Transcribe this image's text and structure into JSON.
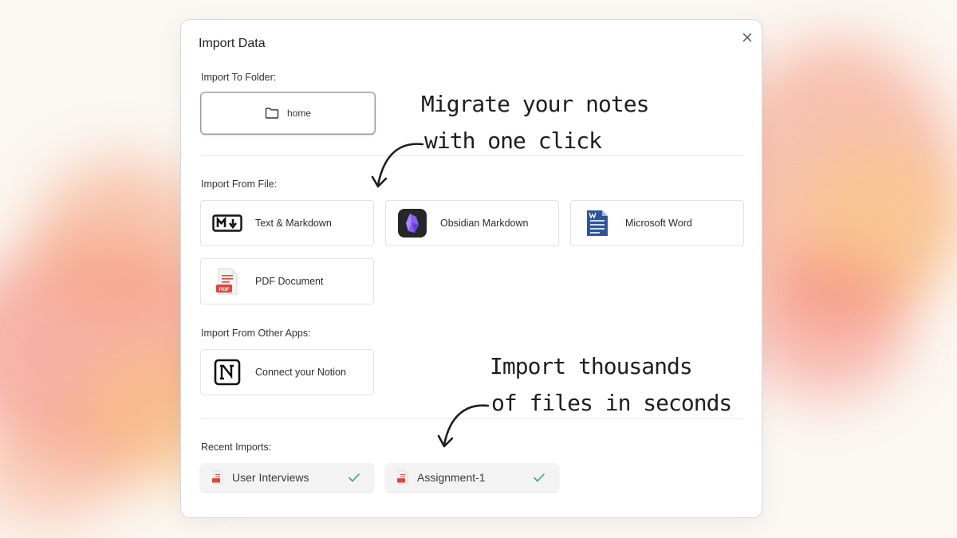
{
  "dialog": {
    "title": "Import Data",
    "close_icon": "close-icon"
  },
  "folder": {
    "label": "Import To Folder:",
    "value": "home",
    "icon": "folder-icon"
  },
  "file_import": {
    "label": "Import From File:",
    "options": [
      {
        "label": "Text & Markdown",
        "icon": "markdown-icon"
      },
      {
        "label": "Obsidian Markdown",
        "icon": "obsidian-icon"
      },
      {
        "label": "Microsoft Word",
        "icon": "word-icon"
      },
      {
        "label": "PDF Document",
        "icon": "pdf-icon"
      }
    ]
  },
  "apps_import": {
    "label": "Import From Other Apps:",
    "options": [
      {
        "label": "Connect your Notion",
        "icon": "notion-icon"
      }
    ]
  },
  "recent": {
    "label": "Recent Imports:",
    "items": [
      {
        "name": "User Interviews",
        "status": "done"
      },
      {
        "name": "Assignment-1",
        "status": "done"
      }
    ]
  },
  "annotations": {
    "top_line1": "Migrate your notes",
    "top_line2": "with one click",
    "bottom_line1": "Import thousands",
    "bottom_line2": "of files in seconds"
  },
  "colors": {
    "check": "#3aa76d",
    "pdf_red": "#e0463c",
    "word_blue": "#2b579a",
    "obsidian_purple": "#7c4dd8"
  }
}
